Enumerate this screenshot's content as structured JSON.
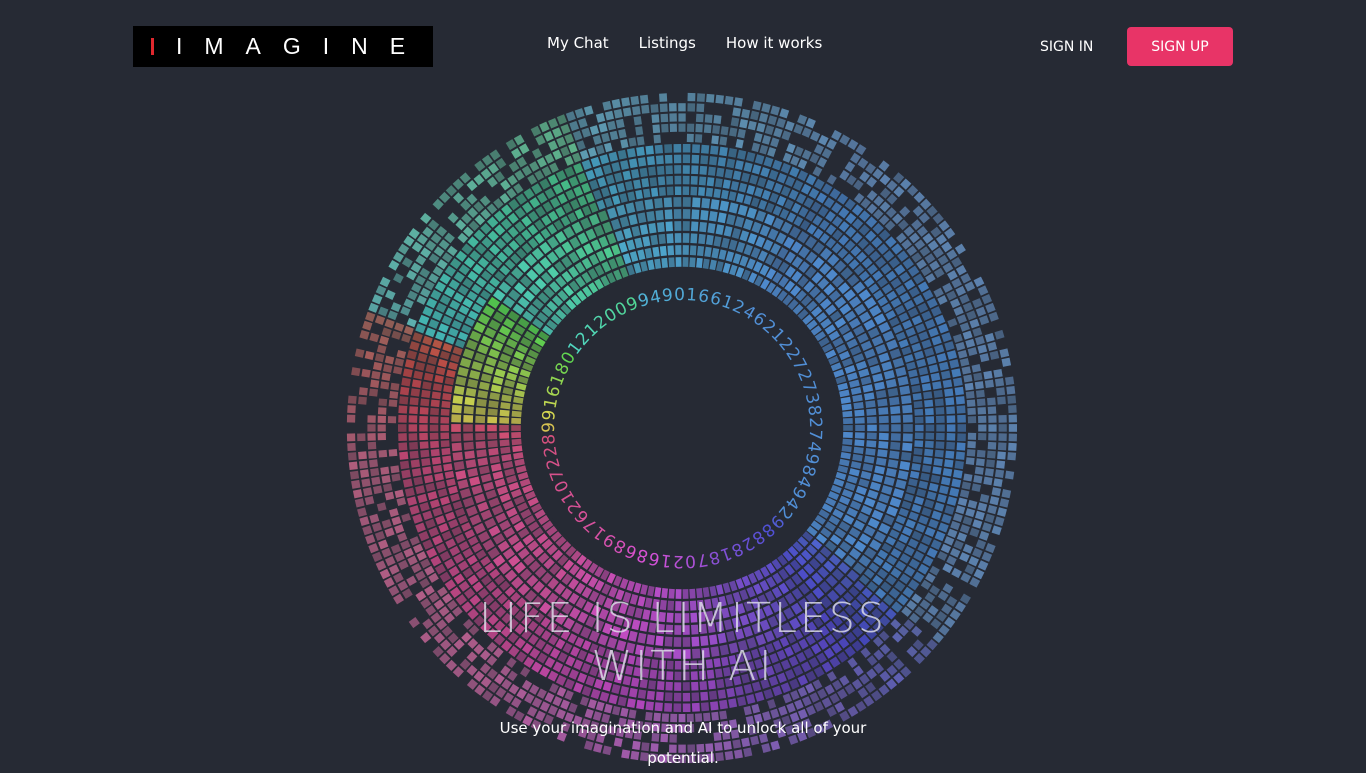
{
  "brand": {
    "logo_text": "IMAGINE",
    "accent_color": "#e0282e"
  },
  "nav": {
    "items": [
      {
        "label": "My Chat"
      },
      {
        "label": "Listings"
      },
      {
        "label": "How it works"
      }
    ]
  },
  "auth": {
    "sign_in": "SIGN IN",
    "sign_up": "SIGN UP",
    "sign_up_color": "#e83467"
  },
  "hero": {
    "headline_line1": "LIFE IS LIMITLESS",
    "headline_line2": "WITH AI",
    "subtitle": "Use your imagination and AI to unlock all of your potential.",
    "ring_glyphs": [
      "4",
      "9",
      "0",
      "1",
      "6",
      "6",
      "1",
      "2",
      "4",
      "6",
      "2",
      "1",
      "2",
      "2",
      "7",
      "2",
      "7",
      "3",
      "8",
      "2",
      "7",
      "4",
      "9",
      "8",
      "4",
      "9",
      "4",
      "2",
      "9",
      "8",
      "8",
      "2",
      "8",
      "1",
      "8",
      "7",
      "0",
      "2",
      "1",
      "6",
      "8",
      "6",
      "8",
      "9",
      "1",
      "7",
      "6",
      "2",
      "1",
      "0",
      "7",
      "2",
      "2",
      "8",
      "9",
      "9",
      "1",
      "6",
      "1",
      "8",
      "0",
      "1",
      "2",
      "1",
      "2",
      "0",
      "0",
      "9",
      "9"
    ]
  },
  "page": {
    "background": "#262a34"
  }
}
